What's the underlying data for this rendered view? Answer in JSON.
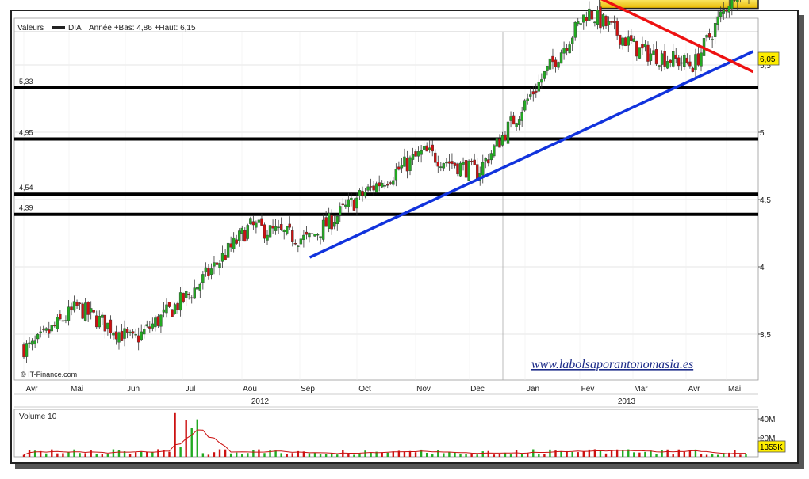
{
  "header": {
    "prefix": "Valeurs",
    "ticker": "DIA",
    "range_text": "Année +Bas: 4,86 +Haut: 6,15"
  },
  "source": "© IT-Finance.com",
  "watermark": "www.labolsaporantonomasia.es",
  "last_price_label": "6,05",
  "volume": {
    "title": "Volume 10",
    "ticks": [
      "40M",
      "20M"
    ],
    "last_label": "1355K"
  },
  "colors": {
    "up": "#22aa22",
    "down": "#cc1111",
    "resistance": "#ee1111",
    "support": "#1133dd",
    "zone_fill": "#ffdd33",
    "level": "#000000",
    "volume_ma": "#cc1111",
    "watermark": "#1a2a88"
  },
  "chart_data": {
    "type": "candlestick",
    "x_labels": [
      "Avr",
      "Mai",
      "Jun",
      "Jul",
      "Aou",
      "Sep",
      "Oct",
      "Nov",
      "Dec",
      "Jan",
      "Fev",
      "Mar",
      "Avr",
      "Mai"
    ],
    "year_labels": [
      "2012",
      "2013"
    ],
    "y_ticks": [
      "5,5",
      "5",
      "4,5",
      "4",
      "3,5"
    ],
    "ylim": [
      3.2,
      6.3
    ],
    "horizontal_levels": [
      {
        "label": "5,33",
        "value": 5.33
      },
      {
        "label": "4,95",
        "value": 4.95
      },
      {
        "label": "4,54",
        "value": 4.54
      },
      {
        "label": "4,39",
        "value": 4.39
      }
    ],
    "resistance_zone": [
      5.92,
      6.0
    ],
    "support_trendline": [
      {
        "date": "2012-09-01",
        "value": 4.07
      },
      {
        "date": "2013-05-15",
        "value": 5.6
      }
    ],
    "resistance_trendline": [
      {
        "date": "2012-12-28",
        "value": 6.25
      },
      {
        "date": "2013-05-15",
        "value": 5.45
      }
    ],
    "price_anchors": [
      {
        "month": "Avr 2012",
        "close": 3.4
      },
      {
        "month": "Mai 2012",
        "close": 3.7
      },
      {
        "month": "Jun 2012",
        "close": 3.45
      },
      {
        "month": "Jul 2012",
        "close": 3.8
      },
      {
        "month": "Aou 2012",
        "close": 4.3
      },
      {
        "month": "Sep 2012",
        "close": 4.2
      },
      {
        "month": "Oct 2012",
        "close": 4.55
      },
      {
        "month": "Nov 2012",
        "close": 4.85
      },
      {
        "month": "Dec 2012",
        "close": 4.7
      },
      {
        "month": "Jan 2013",
        "close": 5.3
      },
      {
        "month": "Fev 2013",
        "close": 5.9
      },
      {
        "month": "Mar 2013",
        "close": 5.6
      },
      {
        "month": "Avr 2013",
        "close": 5.5
      },
      {
        "month": "Mai 2013",
        "close": 6.05
      }
    ],
    "last": 6.05,
    "volume_ylim": [
      0,
      50
    ]
  }
}
